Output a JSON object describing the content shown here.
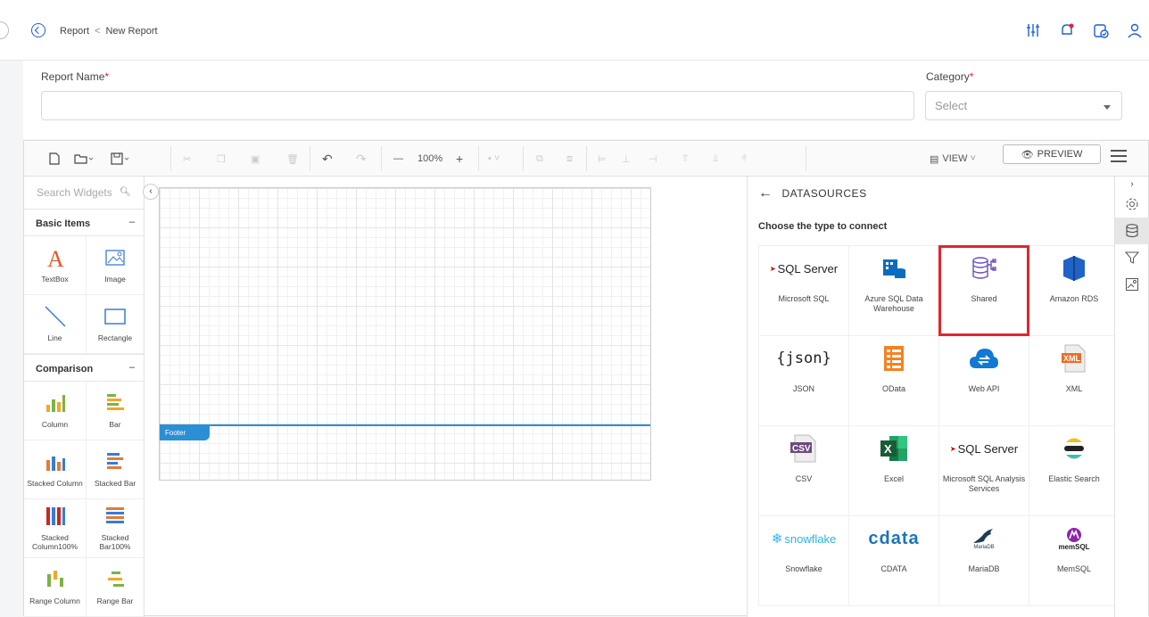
{
  "header": {
    "breadcrumb_root": "Report",
    "breadcrumb_sep": "<",
    "breadcrumb_current": "New Report",
    "icons": [
      "settings-sliders-icon",
      "notification-bell-icon",
      "task-check-icon",
      "user-icon"
    ]
  },
  "form": {
    "report_name_label": "Report Name",
    "category_label": "Category",
    "required_mark": "*",
    "report_name_value": "",
    "category_placeholder": "Select"
  },
  "toolbar": {
    "zoom": "100%",
    "zoom_out": "—",
    "zoom_in": "+",
    "view_label": "VIEW",
    "preview_label": "PREVIEW"
  },
  "widgets": {
    "search_placeholder": "Search Widgets",
    "groups": [
      {
        "title": "Basic Items",
        "items": [
          "TextBox",
          "Image",
          "Line",
          "Rectangle"
        ]
      },
      {
        "title": "Comparison",
        "items": [
          "Column",
          "Bar",
          "Stacked Column",
          "Stacked Bar",
          "Stacked Column100%",
          "Stacked Bar100%",
          "Range Column",
          "Range Bar"
        ]
      }
    ],
    "collapse_symbol": "–"
  },
  "canvas": {
    "footer_label": "Footer"
  },
  "datasources": {
    "title": "DATASOURCES",
    "subtitle": "Choose the type to connect",
    "items": [
      {
        "label": "Microsoft SQL",
        "logo": "SQL Server",
        "selected": false
      },
      {
        "label": "Azure SQL Data Warehouse",
        "logo": "",
        "selected": false
      },
      {
        "label": "Shared",
        "logo": "",
        "selected": true
      },
      {
        "label": "Amazon RDS",
        "logo": "",
        "selected": false
      },
      {
        "label": "JSON",
        "logo": "{json}",
        "selected": false
      },
      {
        "label": "OData",
        "logo": "",
        "selected": false
      },
      {
        "label": "Web API",
        "logo": "",
        "selected": false
      },
      {
        "label": "XML",
        "logo": "XML",
        "selected": false
      },
      {
        "label": "CSV",
        "logo": "CSV",
        "selected": false
      },
      {
        "label": "Excel",
        "logo": "X",
        "selected": false
      },
      {
        "label": "Microsoft SQL Analysis Services",
        "logo": "SQL Server",
        "selected": false
      },
      {
        "label": "Elastic Search",
        "logo": "",
        "selected": false
      },
      {
        "label": "Snowflake",
        "logo": "snowflake",
        "selected": false
      },
      {
        "label": "CDATA",
        "logo": "cdata",
        "selected": false
      },
      {
        "label": "MariaDB",
        "logo": "MariaDB",
        "selected": false
      },
      {
        "label": "MemSQL",
        "logo": "memSQL",
        "selected": false
      }
    ]
  },
  "colors": {
    "accent": "#1f5ed9",
    "footer_band": "#2b8fd6",
    "selection": "#e0262d"
  }
}
